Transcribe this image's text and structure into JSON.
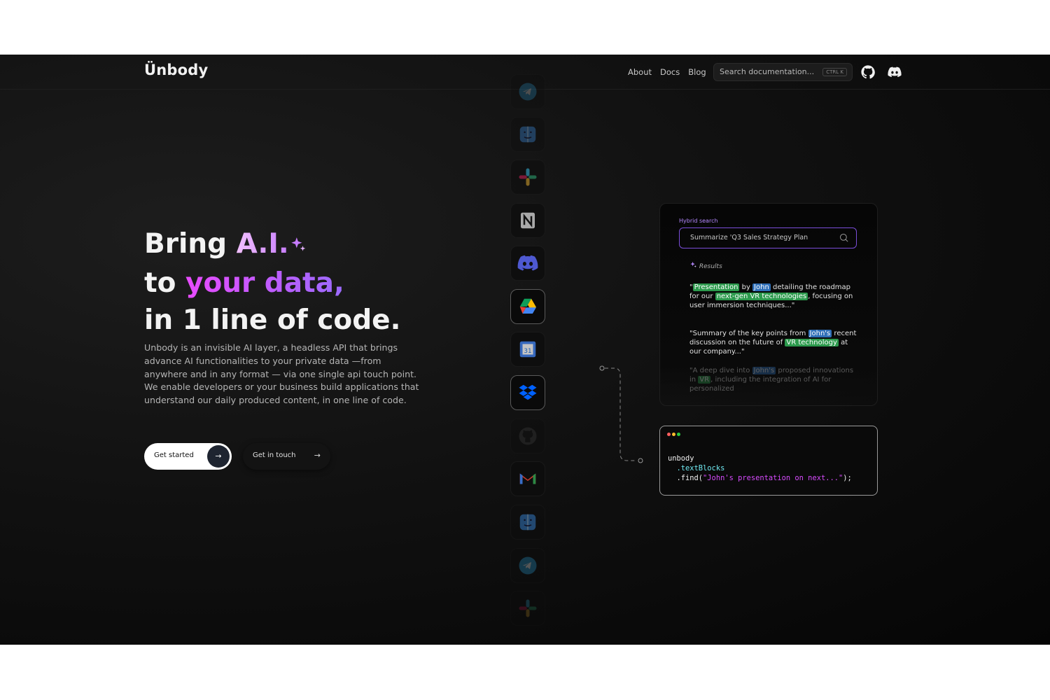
{
  "header": {
    "logo": "Ünbody",
    "nav": [
      "About",
      "Docs",
      "Blog"
    ],
    "search_placeholder": "Search documentation...",
    "search_shortcut": "CTRL K",
    "icons": [
      "github-icon",
      "discord-icon"
    ]
  },
  "hero": {
    "line1_prefix": "Bring ",
    "line1_highlight": "A.I.",
    "line2_prefix": "to ",
    "line2_highlight": "your data,",
    "line3": "in 1 line of code.",
    "description": "Unbody is an invisible AI layer, a headless API that brings advance AI functionalities to your private data —from anywhere and in any format — via one single api touch point. We enable developers or your business build applications that understand our daily produced content, in one line of code.",
    "btn_primary": "Get started",
    "btn_secondary": "Get in touch"
  },
  "apps": [
    "telegram",
    "finder",
    "slack",
    "notion",
    "discord",
    "google-drive",
    "google-calendar",
    "dropbox",
    "github",
    "gmail",
    "finder",
    "telegram",
    "slack"
  ],
  "search_card": {
    "label": "Hybrid search",
    "query": "Summarize 'Q3 Sales Strategy Plan",
    "results_label": "Results",
    "r1": {
      "q1": "\"",
      "h1": "Presentation",
      "t1": " by ",
      "h2": "John",
      "t2": " detailing the roadmap for our ",
      "h3": "next-gen VR technologies",
      "t3": ", focusing on user immersion techniques...\""
    },
    "r2": {
      "t1": "\"Summary of the key points from ",
      "h1": "John's",
      "t2": " recent discussion on the future of ",
      "h2": "VR technology",
      "t3": " at our company...\""
    },
    "r3": {
      "t1": "\"A deep dive into ",
      "h1": "John's",
      "t2": " proposed innovations in ",
      "h2": "VR",
      "t3": ", including the integration of AI for personalized"
    }
  },
  "code_card": {
    "line1": "unbody",
    "line2": "  .textBlocks",
    "line3_a": "  .find(",
    "line3_str": "\"John's presentation on next...\"",
    "line3_b": ");",
    "dot_colors": [
      "#ff5f5f",
      "#ffbd2e",
      "#28c940"
    ]
  }
}
